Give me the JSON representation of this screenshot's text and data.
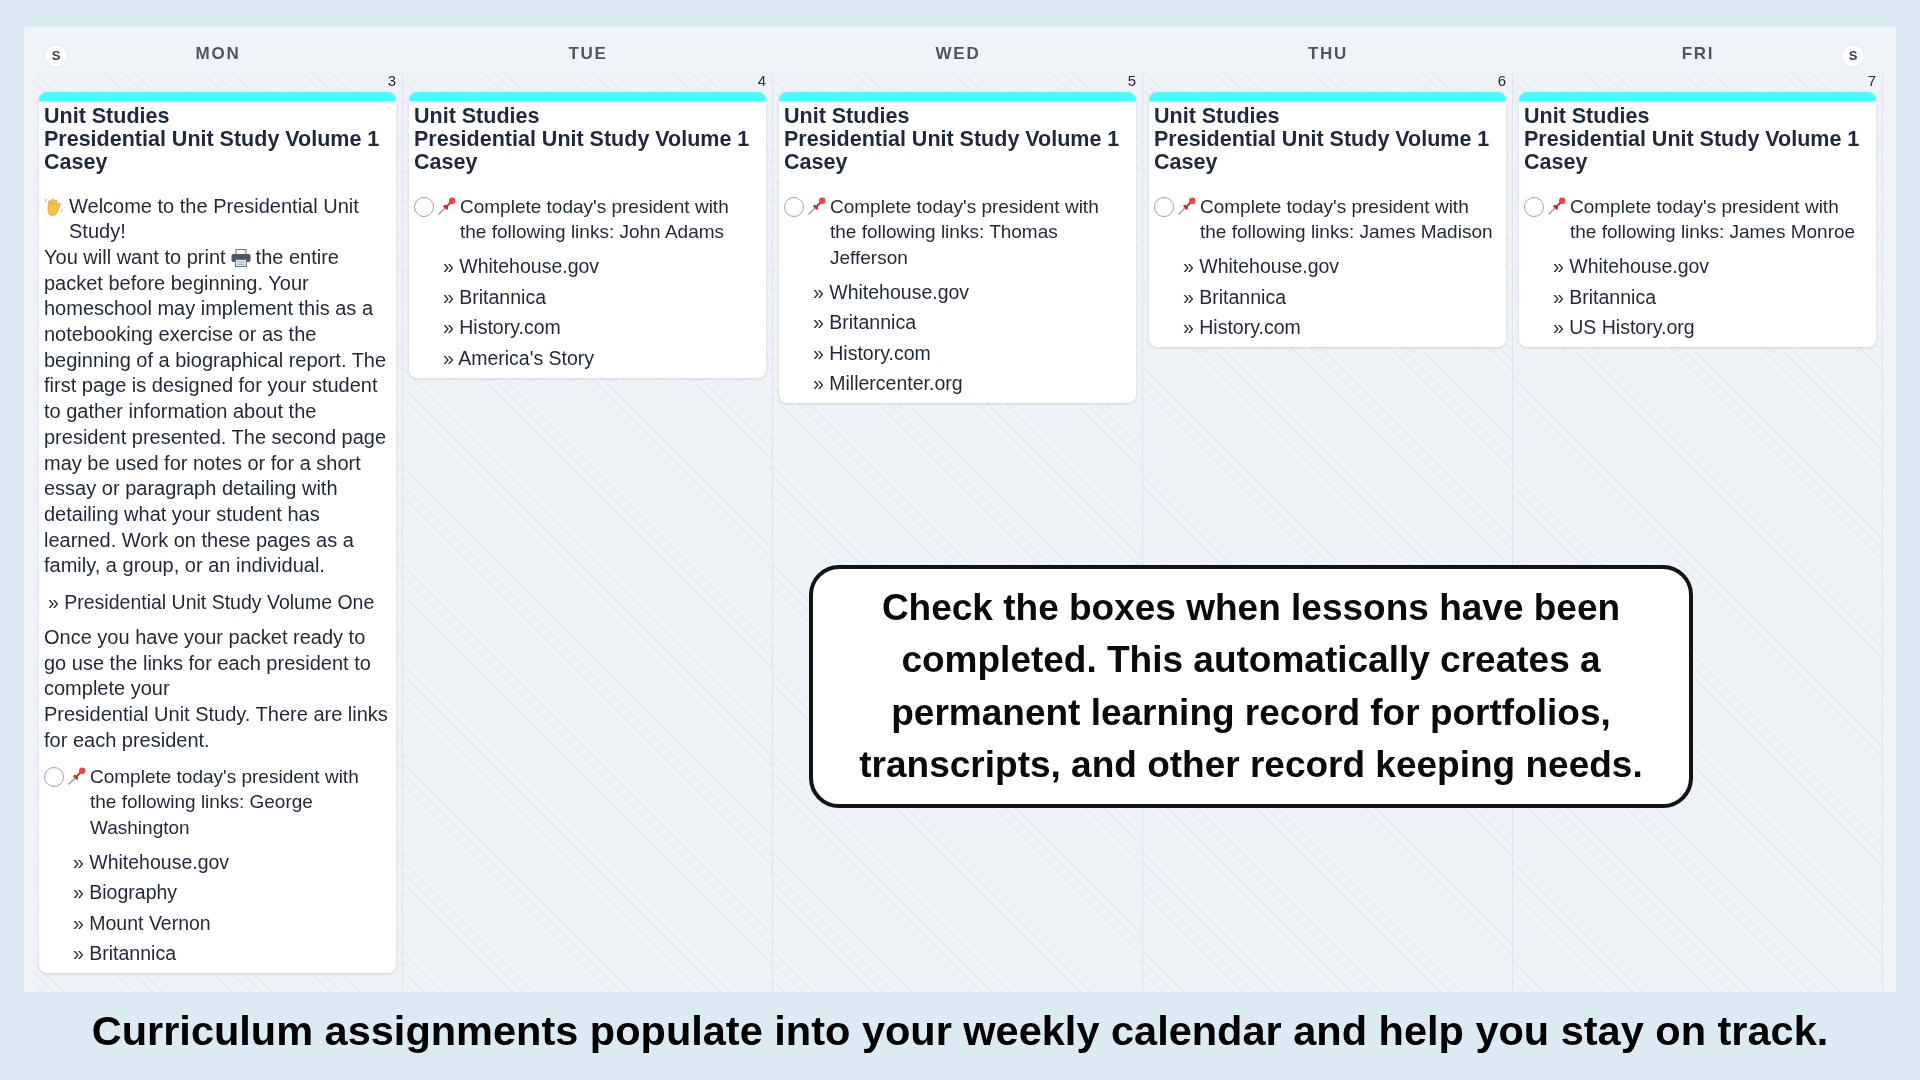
{
  "calendar": {
    "weekend_toggles": [
      {
        "label": "S"
      },
      {
        "label": "S"
      }
    ],
    "days": [
      {
        "label": "MON",
        "date": "3",
        "entries": [
          {
            "color": "#48fdfd",
            "subject": "Unit Studies",
            "course": "Presidential Unit Study Volume 1",
            "student": "Casey",
            "blocks": [
              {
                "kind": "paragraph",
                "lines": [
                  [
                    {
                      "kind": "wave"
                    },
                    {
                      "kind": "text",
                      "text": "Welcome to the Presidential Unit Study!"
                    }
                  ],
                  [
                    {
                      "kind": "text",
                      "text": "You will want to print"
                    },
                    {
                      "kind": "printer"
                    },
                    {
                      "kind": "text",
                      "text": "the entire"
                    }
                  ],
                  [
                    {
                      "kind": "text",
                      "text": "packet before beginning. Your homeschool may implement this as a notebooking exercise or as the beginning of a biographical report. The first page is designed for your student to gather information about the president presented. The second page may be used for notes or for a short essay or paragraph detailing with detailing what your student has learned. Work on these pages as a family, a group, or an individual."
                    }
                  ]
                ]
              },
              {
                "kind": "link",
                "text": "» Presidential Unit Study Volume One"
              },
              {
                "kind": "paragraph",
                "lines": [
                  [
                    {
                      "kind": "text",
                      "text": "Once you have your packet ready to go use the links for each president to complete your"
                    }
                  ],
                  [
                    {
                      "kind": "text",
                      "text": "Presidential Unit Study. There are links for each president."
                    }
                  ]
                ]
              },
              {
                "kind": "task",
                "checked": false,
                "text": "Complete today's president with the following links: George Washington",
                "links": [
                  "» Whitehouse.gov",
                  "» Biography",
                  "» Mount Vernon",
                  "» Britannica"
                ]
              }
            ]
          }
        ]
      },
      {
        "label": "TUE",
        "date": "4",
        "entries": [
          {
            "color": "#48fdfd",
            "subject": "Unit Studies",
            "course": "Presidential Unit Study Volume 1",
            "student": "Casey",
            "blocks": [
              {
                "kind": "task",
                "checked": false,
                "text": "Complete today's president with the following links: John Adams",
                "links": [
                  "» Whitehouse.gov",
                  "» Britannica",
                  "» History.com",
                  "» America's Story"
                ]
              }
            ]
          }
        ]
      },
      {
        "label": "WED",
        "date": "5",
        "entries": [
          {
            "color": "#48fdfd",
            "subject": "Unit Studies",
            "course": "Presidential Unit Study Volume 1",
            "student": "Casey",
            "blocks": [
              {
                "kind": "task",
                "checked": false,
                "text": "Complete today's president with the following links: Thomas Jefferson",
                "links": [
                  "» Whitehouse.gov",
                  "» Britannica",
                  "» History.com",
                  "» Millercenter.org"
                ]
              }
            ]
          }
        ]
      },
      {
        "label": "THU",
        "date": "6",
        "entries": [
          {
            "color": "#48fdfd",
            "subject": "Unit Studies",
            "course": "Presidential Unit Study Volume 1",
            "student": "Casey",
            "blocks": [
              {
                "kind": "task",
                "checked": false,
                "text": "Complete today's president with the following links: James Madison",
                "links": [
                  "» Whitehouse.gov",
                  "» Britannica",
                  "» History.com"
                ]
              }
            ]
          }
        ]
      },
      {
        "label": "FRI",
        "date": "7",
        "entries": [
          {
            "color": "#48fdfd",
            "subject": "Unit Studies",
            "course": "Presidential Unit Study Volume 1",
            "student": "Casey",
            "blocks": [
              {
                "kind": "task",
                "checked": false,
                "text": "Complete today's president with the following links: James Monroe",
                "links": [
                  "» Whitehouse.gov",
                  "» Britannica",
                  "» US History.org"
                ]
              }
            ]
          }
        ]
      }
    ]
  },
  "callout": {
    "text": "Check the boxes when lessons have been completed. This automatically creates a permanent learning record for portfolios, transcripts, and other record keeping needs."
  },
  "caption": "Curriculum assignments populate into your weekly calendar and help you stay on track."
}
